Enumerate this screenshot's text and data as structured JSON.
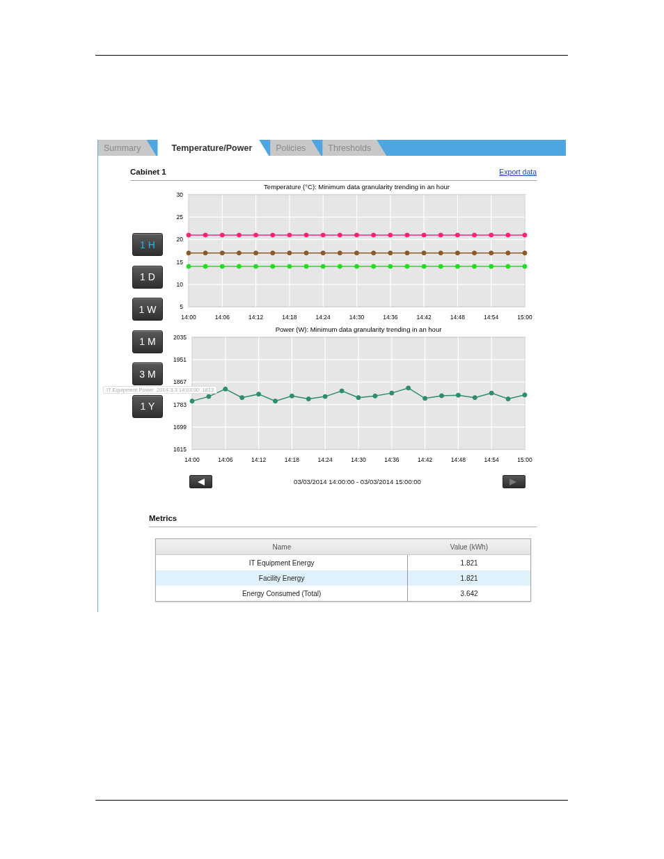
{
  "tabs": [
    {
      "label": "Summary",
      "selected": false
    },
    {
      "label": "Temperature/Power",
      "selected": true
    },
    {
      "label": "Policies",
      "selected": false
    },
    {
      "label": "Thresholds",
      "selected": false
    }
  ],
  "panel_title": "Cabinet 1",
  "export_link": "Export data",
  "range_buttons": [
    {
      "label": "1 H",
      "selected": true
    },
    {
      "label": "1 D",
      "selected": false
    },
    {
      "label": "1 W",
      "selected": false
    },
    {
      "label": "1 M",
      "selected": false
    },
    {
      "label": "3 M",
      "selected": false
    },
    {
      "label": "1 Y",
      "selected": false
    }
  ],
  "charts": [
    {
      "chart_data": {
        "type": "line",
        "grid": true,
        "title": "Temperature (°C): Minimum data granularity trending in an hour",
        "categories": [
          "14:00",
          null,
          "14:06",
          null,
          "14:12",
          null,
          "14:18",
          null,
          "14:24",
          null,
          "14:30",
          null,
          "14:36",
          null,
          "14:42",
          null,
          "14:48",
          null,
          "14:54",
          null,
          "15:00"
        ],
        "ylim": [
          5,
          30
        ],
        "yticks": [
          5,
          10,
          15,
          20,
          25,
          30
        ],
        "series": [
          {
            "color": "#ff2277",
            "marker": "circle",
            "values": [
              21,
              21,
              21,
              21,
              21,
              21,
              21,
              21,
              21,
              21,
              21,
              21,
              21,
              21,
              21,
              21,
              21,
              21,
              21,
              21,
              21
            ]
          },
          {
            "color": "#8b5a2b",
            "marker": "circle",
            "values": [
              17,
              17,
              17,
              17,
              17,
              17,
              17,
              17,
              17,
              17,
              17,
              17,
              17,
              17,
              17,
              17,
              17,
              17,
              17,
              17,
              17
            ]
          },
          {
            "color": "#22dd22",
            "marker": "circle",
            "values": [
              14,
              14,
              14,
              14,
              14,
              14,
              14,
              14,
              14,
              14,
              14,
              14,
              14,
              14,
              14,
              14,
              14,
              14,
              14,
              14,
              14
            ]
          }
        ]
      }
    },
    {
      "chart_data": {
        "type": "line",
        "grid": true,
        "title": "Power (W): Minimum data granularity trending in an hour",
        "categories": [
          "14:00",
          null,
          "14:06",
          null,
          "14:12",
          null,
          "14:18",
          null,
          "14:24",
          null,
          "14:30",
          null,
          "14:36",
          null,
          "14:42",
          null,
          "14:48",
          null,
          "14:54",
          null,
          "15:00"
        ],
        "ylim": [
          1615,
          2035
        ],
        "yticks": [
          1615,
          1699,
          1783,
          1867,
          1951,
          2035
        ],
        "series": [
          {
            "color": "#2e8b6e",
            "marker": "circle",
            "values": [
              1796,
              1813,
              1841,
              1809,
              1822,
              1796,
              1815,
              1804,
              1813,
              1834,
              1809,
              1815,
              1826,
              1845,
              1806,
              1816,
              1818,
              1809,
              1826,
              1804,
              1819
            ]
          }
        ]
      }
    }
  ],
  "tooltip": "IT Equipment Power  2014-3-3 14:03:00  1813",
  "navigation": {
    "previous": {
      "disabled": false
    },
    "range": "03/03/2014 14:00:00 - 03/03/2014 15:00:00",
    "next": {
      "disabled": true
    }
  },
  "metrics": {
    "title": "Metrics",
    "columns": [
      "Name",
      "Value (kWh)"
    ],
    "rows": [
      {
        "cells": [
          "IT Equipment Energy",
          "1.821"
        ],
        "selected": false
      },
      {
        "cells": [
          "Facility Energy",
          "1.821"
        ],
        "selected": true
      },
      {
        "cells": [
          "Energy Consumed (Total)",
          "3.642"
        ],
        "selected": false
      }
    ]
  }
}
